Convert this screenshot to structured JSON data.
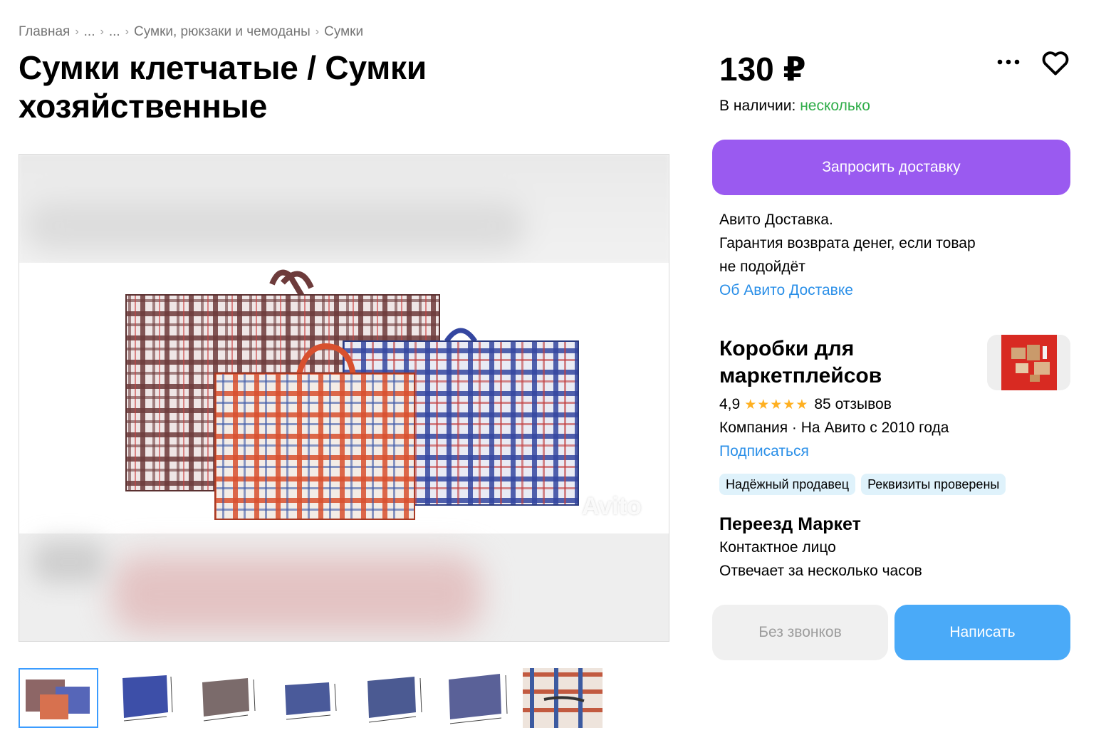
{
  "breadcrumb": {
    "items": [
      "Главная",
      "...",
      "...",
      "Сумки, рюкзаки и чемоданы",
      "Сумки"
    ],
    "separator": "›"
  },
  "listing": {
    "title": "Сумки клетчатые / Сумки хозяйственные",
    "price": "130 ₽",
    "availability_label": "В наличии:",
    "availability_value": "несколько",
    "watermark": "Avito"
  },
  "actions": {
    "more_icon": "more-dots-icon",
    "favorite_icon": "heart-icon",
    "request_delivery": "Запросить доставку",
    "no_calls": "Без звонков",
    "write": "Написать"
  },
  "delivery": {
    "line1": "Авито Доставка.",
    "line2": "Гарантия возврата денег, если товар",
    "line3": "не подойдёт",
    "link": "Об Авито Доставке"
  },
  "seller": {
    "name": "Коробки для маркетплейсов",
    "rating": "4,9",
    "stars": "★★★★★",
    "reviews": "85 отзывов",
    "company": "Компания · На Авито с 2010 года",
    "subscribe": "Подписаться",
    "badges": [
      "Надёжный продавец",
      "Реквизиты проверены"
    ]
  },
  "contact": {
    "name": "Переезд Маркет",
    "role": "Контактное лицо",
    "response": "Отвечает за несколько часов"
  },
  "thumbnails": {
    "count": 7,
    "active_index": 0
  },
  "colors": {
    "accent_purple": "#9a5af0",
    "accent_blue": "#4aaaf8",
    "link_blue": "#2a8fe8",
    "available_green": "#2fad49",
    "badge_bg": "#dff2fb",
    "star": "#ffb021"
  }
}
